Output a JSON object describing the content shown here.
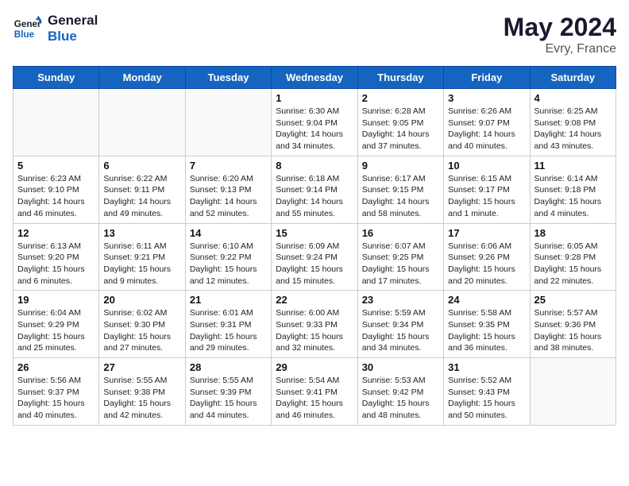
{
  "logo": {
    "line1": "General",
    "line2": "Blue"
  },
  "title": "May 2024",
  "subtitle": "Evry, France",
  "weekdays": [
    "Sunday",
    "Monday",
    "Tuesday",
    "Wednesday",
    "Thursday",
    "Friday",
    "Saturday"
  ],
  "weeks": [
    [
      {
        "day": "",
        "info": ""
      },
      {
        "day": "",
        "info": ""
      },
      {
        "day": "",
        "info": ""
      },
      {
        "day": "1",
        "info": "Sunrise: 6:30 AM\nSunset: 9:04 PM\nDaylight: 14 hours\nand 34 minutes."
      },
      {
        "day": "2",
        "info": "Sunrise: 6:28 AM\nSunset: 9:05 PM\nDaylight: 14 hours\nand 37 minutes."
      },
      {
        "day": "3",
        "info": "Sunrise: 6:26 AM\nSunset: 9:07 PM\nDaylight: 14 hours\nand 40 minutes."
      },
      {
        "day": "4",
        "info": "Sunrise: 6:25 AM\nSunset: 9:08 PM\nDaylight: 14 hours\nand 43 minutes."
      }
    ],
    [
      {
        "day": "5",
        "info": "Sunrise: 6:23 AM\nSunset: 9:10 PM\nDaylight: 14 hours\nand 46 minutes."
      },
      {
        "day": "6",
        "info": "Sunrise: 6:22 AM\nSunset: 9:11 PM\nDaylight: 14 hours\nand 49 minutes."
      },
      {
        "day": "7",
        "info": "Sunrise: 6:20 AM\nSunset: 9:13 PM\nDaylight: 14 hours\nand 52 minutes."
      },
      {
        "day": "8",
        "info": "Sunrise: 6:18 AM\nSunset: 9:14 PM\nDaylight: 14 hours\nand 55 minutes."
      },
      {
        "day": "9",
        "info": "Sunrise: 6:17 AM\nSunset: 9:15 PM\nDaylight: 14 hours\nand 58 minutes."
      },
      {
        "day": "10",
        "info": "Sunrise: 6:15 AM\nSunset: 9:17 PM\nDaylight: 15 hours\nand 1 minute."
      },
      {
        "day": "11",
        "info": "Sunrise: 6:14 AM\nSunset: 9:18 PM\nDaylight: 15 hours\nand 4 minutes."
      }
    ],
    [
      {
        "day": "12",
        "info": "Sunrise: 6:13 AM\nSunset: 9:20 PM\nDaylight: 15 hours\nand 6 minutes."
      },
      {
        "day": "13",
        "info": "Sunrise: 6:11 AM\nSunset: 9:21 PM\nDaylight: 15 hours\nand 9 minutes."
      },
      {
        "day": "14",
        "info": "Sunrise: 6:10 AM\nSunset: 9:22 PM\nDaylight: 15 hours\nand 12 minutes."
      },
      {
        "day": "15",
        "info": "Sunrise: 6:09 AM\nSunset: 9:24 PM\nDaylight: 15 hours\nand 15 minutes."
      },
      {
        "day": "16",
        "info": "Sunrise: 6:07 AM\nSunset: 9:25 PM\nDaylight: 15 hours\nand 17 minutes."
      },
      {
        "day": "17",
        "info": "Sunrise: 6:06 AM\nSunset: 9:26 PM\nDaylight: 15 hours\nand 20 minutes."
      },
      {
        "day": "18",
        "info": "Sunrise: 6:05 AM\nSunset: 9:28 PM\nDaylight: 15 hours\nand 22 minutes."
      }
    ],
    [
      {
        "day": "19",
        "info": "Sunrise: 6:04 AM\nSunset: 9:29 PM\nDaylight: 15 hours\nand 25 minutes."
      },
      {
        "day": "20",
        "info": "Sunrise: 6:02 AM\nSunset: 9:30 PM\nDaylight: 15 hours\nand 27 minutes."
      },
      {
        "day": "21",
        "info": "Sunrise: 6:01 AM\nSunset: 9:31 PM\nDaylight: 15 hours\nand 29 minutes."
      },
      {
        "day": "22",
        "info": "Sunrise: 6:00 AM\nSunset: 9:33 PM\nDaylight: 15 hours\nand 32 minutes."
      },
      {
        "day": "23",
        "info": "Sunrise: 5:59 AM\nSunset: 9:34 PM\nDaylight: 15 hours\nand 34 minutes."
      },
      {
        "day": "24",
        "info": "Sunrise: 5:58 AM\nSunset: 9:35 PM\nDaylight: 15 hours\nand 36 minutes."
      },
      {
        "day": "25",
        "info": "Sunrise: 5:57 AM\nSunset: 9:36 PM\nDaylight: 15 hours\nand 38 minutes."
      }
    ],
    [
      {
        "day": "26",
        "info": "Sunrise: 5:56 AM\nSunset: 9:37 PM\nDaylight: 15 hours\nand 40 minutes."
      },
      {
        "day": "27",
        "info": "Sunrise: 5:55 AM\nSunset: 9:38 PM\nDaylight: 15 hours\nand 42 minutes."
      },
      {
        "day": "28",
        "info": "Sunrise: 5:55 AM\nSunset: 9:39 PM\nDaylight: 15 hours\nand 44 minutes."
      },
      {
        "day": "29",
        "info": "Sunrise: 5:54 AM\nSunset: 9:41 PM\nDaylight: 15 hours\nand 46 minutes."
      },
      {
        "day": "30",
        "info": "Sunrise: 5:53 AM\nSunset: 9:42 PM\nDaylight: 15 hours\nand 48 minutes."
      },
      {
        "day": "31",
        "info": "Sunrise: 5:52 AM\nSunset: 9:43 PM\nDaylight: 15 hours\nand 50 minutes."
      },
      {
        "day": "",
        "info": ""
      }
    ]
  ]
}
